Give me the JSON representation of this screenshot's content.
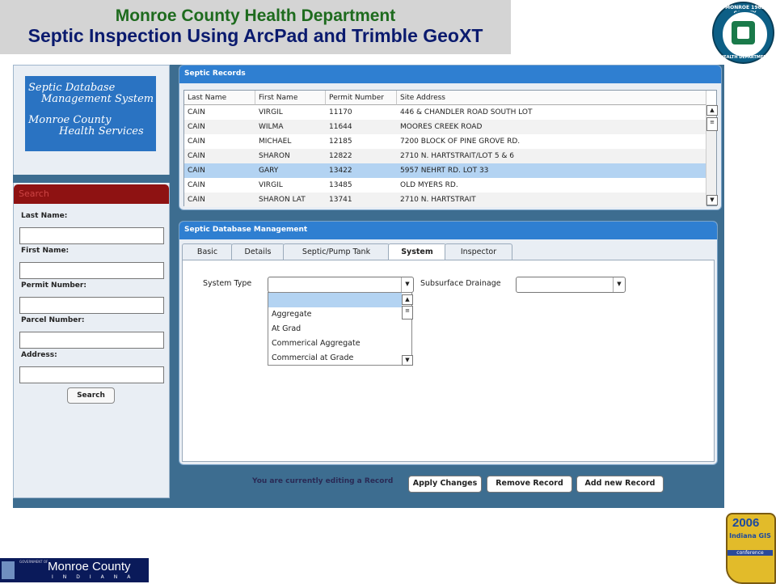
{
  "header": {
    "title_line1": "Monroe County Health Department",
    "title_line2": "Septic Inspection Using ArcPad and Trimble GeoXT"
  },
  "seal": {
    "top_text": "MONROE 1965 COUNTY",
    "bottom_text": "HEALTH DEPARTMENT"
  },
  "logo": {
    "line1": "Septic Database",
    "line2": "Management System",
    "line3": "Monroe County",
    "line4": "Health Services"
  },
  "search": {
    "header": "Search",
    "last_name_label": "Last Name:",
    "first_name_label": "First Name:",
    "permit_label": "Permit Number:",
    "parcel_label": "Parcel Number:",
    "address_label": "Address:",
    "button": "Search"
  },
  "records": {
    "title": "Septic Records",
    "columns": [
      "Last Name",
      "First Name",
      "Permit Number",
      "Site Address"
    ],
    "rows": [
      {
        "last": "CAIN",
        "first": "VIRGIL",
        "permit": "11170",
        "address": "446 & CHANDLER ROAD SOUTH LOT"
      },
      {
        "last": "CAIN",
        "first": "WILMA",
        "permit": "11644",
        "address": "MOORES CREEK ROAD"
      },
      {
        "last": "CAIN",
        "first": "MICHAEL",
        "permit": "12185",
        "address": "7200 BLOCK OF PINE GROVE RD."
      },
      {
        "last": "CAIN",
        "first": "SHARON",
        "permit": "12822",
        "address": "2710 N. HARTSTRAIT/LOT 5 & 6"
      },
      {
        "last": "CAIN",
        "first": "GARY",
        "permit": "13422",
        "address": "5957 NEHRT RD.  LOT  33"
      },
      {
        "last": "CAIN",
        "first": "VIRGIL",
        "permit": "13485",
        "address": "OLD MYERS RD."
      },
      {
        "last": "CAIN",
        "first": "SHARON LAT",
        "permit": "13741",
        "address": "2710 N. HARTSTRAIT"
      }
    ],
    "selected_row": 4
  },
  "management": {
    "title": "Septic Database Management",
    "tabs": [
      "Basic",
      "Details",
      "Septic/Pump Tank",
      "System",
      "Inspector"
    ],
    "active_tab": "System",
    "system_type_label": "System Type",
    "subsurface_label": "Subsurface Drainage",
    "system_type_options": [
      "",
      "Aggregate",
      "At Grad",
      "Commerical Aggregate",
      "Commercial at Grade"
    ]
  },
  "actions": {
    "status": "You are currently editing a Record",
    "apply": "Apply Changes",
    "remove": "Remove Record",
    "add": "Add new Record"
  },
  "footer": {
    "gov_text": "GOVERNMENT OF",
    "county_name": "Monroe County",
    "state": "INDIANA",
    "conf_year": "2006",
    "conf_line1": "Indiana GIS",
    "conf_line2": "conference"
  },
  "colors": {
    "panel_header": "#2f7fd1",
    "search_header": "#8e1212",
    "selected_row": "#b3d3f2",
    "app_background": "#3d6d90"
  }
}
